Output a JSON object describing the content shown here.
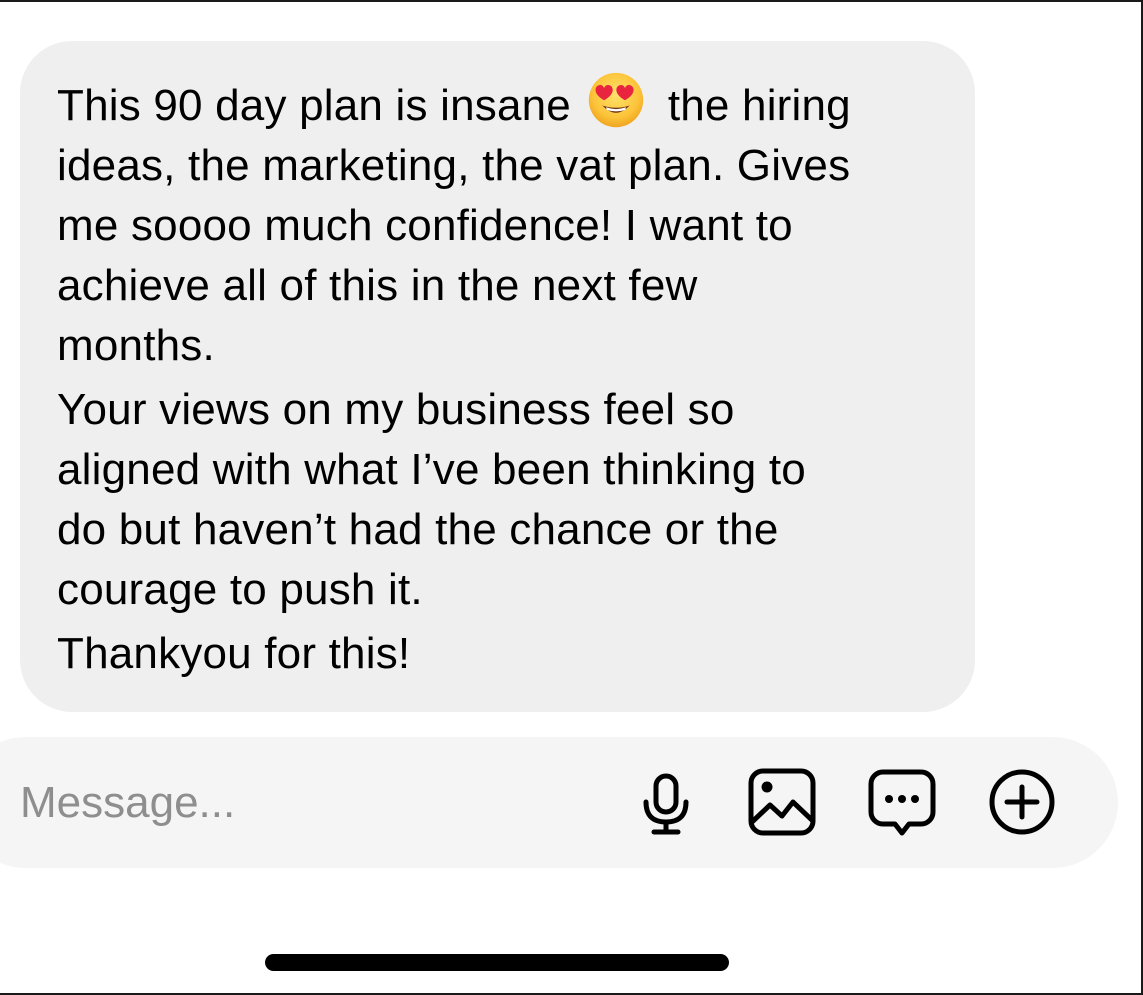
{
  "message": {
    "paragraph1_lines": [
      "This 90 day plan is insane",
      "the hiring",
      "ideas, the marketing, the vat plan. Gives",
      "me soooo much confidence! I want to",
      "achieve all of this in the next few",
      "months."
    ],
    "paragraph2_lines": [
      "Your views on my business feel so",
      "aligned with what I’ve been thinking to",
      "do but haven’t had the chance or the",
      "courage to push it."
    ],
    "paragraph3": "Thankyou for this!",
    "emoji": "smiling-face-with-heart-eyes",
    "bubble_color": "#efefef"
  },
  "composer": {
    "placeholder": "Message...",
    "value": "",
    "icons": {
      "mic": "microphone-icon",
      "gallery": "gallery-icon",
      "sticker": "sticker-icon",
      "add": "plus-circle-icon"
    },
    "background_color": "#f5f5f5"
  }
}
